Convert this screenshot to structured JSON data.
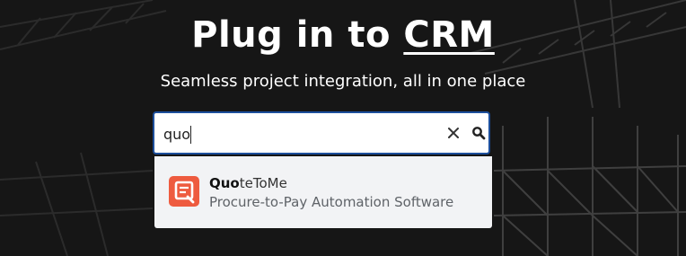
{
  "hero": {
    "headline_prefix": "Plug in to ",
    "headline_link": "CRM",
    "subtitle": "Seamless project integration, all in one place"
  },
  "search": {
    "value": "quo",
    "clear_icon": "close-icon",
    "search_icon": "magnifier-icon"
  },
  "results": [
    {
      "name_match": "Quo",
      "name_rest": "teToMe",
      "description": "Procure-to-Pay Automation Software",
      "logo_icon": "quotetome-logo-icon",
      "logo_color": "#ee5b3f"
    }
  ],
  "colors": {
    "background": "#1c1c1c",
    "search_border": "#1d4f9c",
    "dropdown_bg": "#f2f3f5"
  }
}
